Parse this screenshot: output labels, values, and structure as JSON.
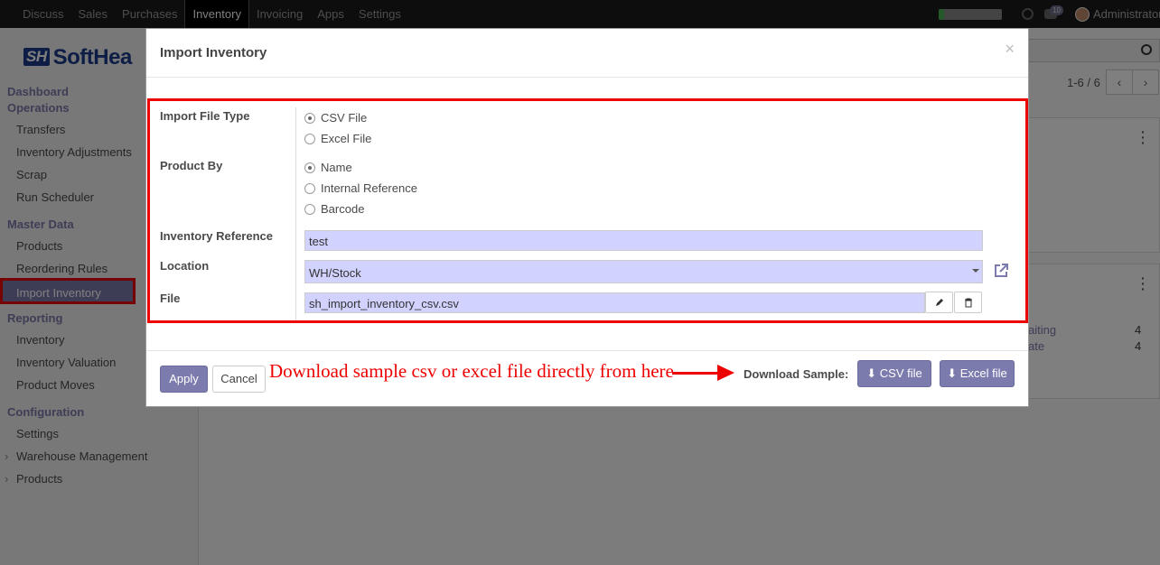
{
  "navbar": {
    "items": [
      "Discuss",
      "Sales",
      "Purchases",
      "Inventory",
      "Invoicing",
      "Apps",
      "Settings"
    ],
    "active_item": "Inventory",
    "message_count": "10",
    "user_name": "Administrator",
    "progress_fraction": 0.08
  },
  "sidebar": {
    "logo_mark": "SH",
    "logo_text": "SoftHea",
    "dashboard": "Dashboard",
    "operations": "Operations",
    "operations_items": [
      "Transfers",
      "Inventory Adjustments",
      "Scrap",
      "Run Scheduler"
    ],
    "master_data": "Master Data",
    "master_items": [
      "Products",
      "Reordering Rules",
      "Import Inventory"
    ],
    "reporting": "Reporting",
    "reporting_items": [
      "Inventory",
      "Inventory Valuation",
      "Product Moves"
    ],
    "configuration": "Configuration",
    "configuration_items": [
      "Settings",
      "Warehouse Management",
      "Products"
    ]
  },
  "background": {
    "pager_text": "1-6 / 6",
    "rows": [
      {
        "label": "aiting",
        "value": "4"
      },
      {
        "label": "ate",
        "value": "4"
      }
    ]
  },
  "modal": {
    "title": "Import Inventory",
    "close": "×",
    "import_file_type_label": "Import File Type",
    "file_types": [
      "CSV File",
      "Excel File"
    ],
    "file_type_selected": "CSV File",
    "product_by_label": "Product By",
    "product_by_options": [
      "Name",
      "Internal Reference",
      "Barcode"
    ],
    "product_by_selected": "Name",
    "inventory_reference_label": "Inventory Reference",
    "inventory_reference_value": "test",
    "location_label": "Location",
    "location_value": "WH/Stock",
    "file_label": "File",
    "file_value": "sh_import_inventory_csv.csv",
    "apply": "Apply",
    "cancel": "Cancel",
    "annotation": "Download sample csv or excel file directly from here",
    "download_sample_label": "Download Sample:",
    "csv_button": "CSV file",
    "excel_button": "Excel file",
    "accent_color": "#7c7bad",
    "highlight_color": "#e00000"
  }
}
